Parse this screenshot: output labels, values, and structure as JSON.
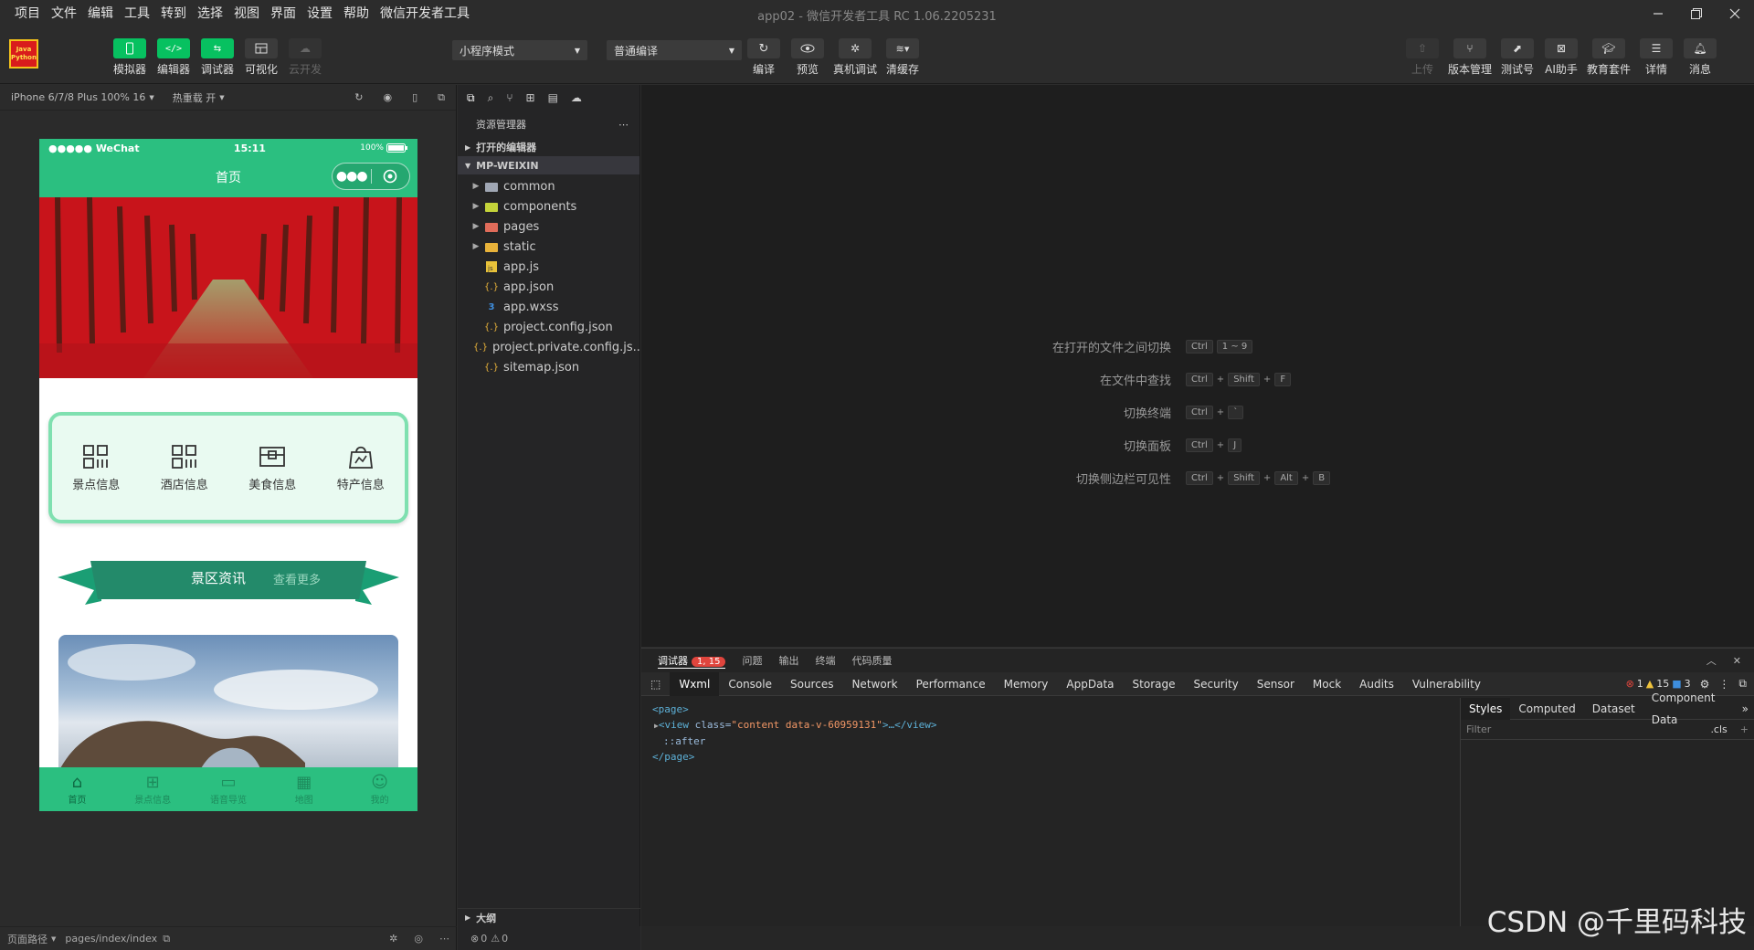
{
  "menubar": {
    "items": [
      "项目",
      "文件",
      "编辑",
      "工具",
      "转到",
      "选择",
      "视图",
      "界面",
      "设置",
      "帮助",
      "微信开发者工具"
    ],
    "title": "app02 - 微信开发者工具 RC 1.06.2205231"
  },
  "toolbar": {
    "logo_text_1": "Java",
    "logo_text_2": "Python",
    "left_buttons": [
      {
        "label": "模拟器",
        "icon": "phone-icon"
      },
      {
        "label": "编辑器",
        "icon": "code-icon"
      },
      {
        "label": "调试器",
        "icon": "debug-icon"
      },
      {
        "label": "可视化",
        "icon": "layout-icon"
      },
      {
        "label": "云开发",
        "icon": "cloud-icon"
      }
    ],
    "mode_select": "小程序模式",
    "compile_select": "普通编译",
    "mid_buttons": [
      {
        "label": "编译",
        "icon": "refresh-icon"
      },
      {
        "label": "预览",
        "icon": "eye-icon"
      },
      {
        "label": "真机调试",
        "icon": "bug-icon"
      },
      {
        "label": "清缓存",
        "icon": "layers-icon"
      }
    ],
    "right_buttons": [
      {
        "label": "上传",
        "icon": "upload-icon"
      },
      {
        "label": "版本管理",
        "icon": "branch-icon"
      },
      {
        "label": "测试号",
        "icon": "external-icon"
      },
      {
        "label": "AI助手",
        "icon": "ai-icon"
      },
      {
        "label": "教育套件",
        "icon": "graduation-icon"
      },
      {
        "label": "详情",
        "icon": "menu-icon"
      },
      {
        "label": "消息",
        "icon": "bell-icon"
      }
    ]
  },
  "simulator": {
    "device": "iPhone 6/7/8 Plus 100% 16",
    "hot_reload": "热重载 开",
    "status_left": "●●●●● WeChat",
    "status_time": "15:11",
    "status_battery": "100%",
    "nav_title": "首页",
    "categories": [
      "景点信息",
      "酒店信息",
      "美食信息",
      "特产信息"
    ],
    "ribbon_title": "景区资讯",
    "ribbon_more": "查看更多",
    "tabs": [
      "首页",
      "景点信息",
      "语音导览",
      "地图",
      "我的"
    ],
    "footer_path_label": "页面路径",
    "footer_path": "pages/index/index"
  },
  "explorer": {
    "title": "资源管理器",
    "open_editors": "打开的编辑器",
    "project": "MP-WEIXIN",
    "files": [
      {
        "name": "common",
        "type": "folder",
        "color": "#a0a7b4"
      },
      {
        "name": "components",
        "type": "folder",
        "color": "#c4d33a"
      },
      {
        "name": "pages",
        "type": "folder",
        "color": "#e06c5a"
      },
      {
        "name": "static",
        "type": "folder",
        "color": "#e8b23a"
      },
      {
        "name": "app.js",
        "type": "js"
      },
      {
        "name": "app.json",
        "type": "json"
      },
      {
        "name": "app.wxss",
        "type": "wxss"
      },
      {
        "name": "project.config.json",
        "type": "json"
      },
      {
        "name": "project.private.config.js...",
        "type": "json"
      },
      {
        "name": "sitemap.json",
        "type": "json"
      }
    ],
    "outline": "大纲",
    "footer_errors": "0",
    "footer_warnings": "0"
  },
  "editor": {
    "shortcuts": [
      {
        "label": "在打开的文件之间切换",
        "keys": [
          "Ctrl",
          "1 ~ 9"
        ]
      },
      {
        "label": "在文件中查找",
        "keys": [
          "Ctrl",
          "+",
          "Shift",
          "+",
          "F"
        ]
      },
      {
        "label": "切换终端",
        "keys": [
          "Ctrl",
          "+",
          "`"
        ]
      },
      {
        "label": "切换面板",
        "keys": [
          "Ctrl",
          "+",
          "J"
        ]
      },
      {
        "label": "切换侧边栏可见性",
        "keys": [
          "Ctrl",
          "+",
          "Shift",
          "+",
          "Alt",
          "+",
          "B"
        ]
      }
    ]
  },
  "debugger": {
    "tabs": [
      "调试器",
      "问题",
      "输出",
      "终端",
      "代码质量"
    ],
    "badge": "1, 15",
    "devtools_tabs": [
      "Wxml",
      "Console",
      "Sources",
      "Network",
      "Performance",
      "Memory",
      "AppData",
      "Storage",
      "Security",
      "Sensor",
      "Mock",
      "Audits",
      "Vulnerability"
    ],
    "counts": {
      "errors": "1",
      "warnings": "15",
      "info": "3"
    },
    "dom": {
      "page_open": "<page>",
      "view_tag": "view",
      "view_attr_name": "class",
      "view_attr_value": "\"content data-v-60959131\"",
      "view_tail": ">…</view>",
      "after": "::after",
      "page_close": "</page>"
    },
    "styles_tabs": [
      "Styles",
      "Computed",
      "Dataset",
      "Component Data"
    ],
    "filter_placeholder": "Filter",
    "cls": ".cls"
  },
  "watermark": "CSDN @千里码科技",
  "colors": {
    "accent": "#07c160",
    "phone_green": "#2bbf80",
    "badge_red": "#e0453d"
  }
}
